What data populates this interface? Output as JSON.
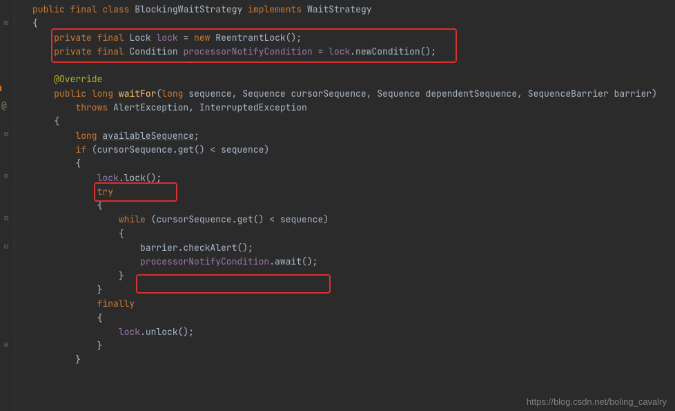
{
  "code": {
    "line0_public": "public",
    "line0_final": "final",
    "line0_class": "class",
    "line0_name": "BlockingWaitStrategy",
    "line0_implements": "implements",
    "line0_iface": "WaitStrategy",
    "brace_open": "{",
    "brace_close": "}",
    "field1_private": "private",
    "field1_final": "final",
    "field1_type": "Lock",
    "field1_name": "lock",
    "field1_eq": " = ",
    "field1_new": "new",
    "field1_ctor": "ReentrantLock()",
    "semi": ";",
    "field2_private": "private",
    "field2_final": "final",
    "field2_type": "Condition",
    "field2_name": "processorNotifyCondition",
    "field2_eq": " = ",
    "field2_rhs1": "lock",
    "field2_dot": ".",
    "field2_rhs2": "newCondition()",
    "ann_override": "@Override",
    "m_public": "public",
    "m_ret": "long",
    "m_name": "waitFor",
    "m_p1t": "long",
    "m_p1n": "sequence",
    "m_p2t": "Sequence",
    "m_p2n": "cursorSequence",
    "m_p3t": "Sequence",
    "m_p3n": "dependentSequence",
    "m_p4t": "SequenceBarrier",
    "m_p4n": "barrier",
    "throws": "throws",
    "ex1": "AlertException",
    "ex2": "InterruptedException",
    "body_longkw": "long",
    "body_avail": "availableSequence",
    "if_kw": "if",
    "if_cond": "(cursorSequence.get() < sequence)",
    "lock_call": "lock",
    "lock_dot": ".",
    "lock_method": "lock()",
    "try_kw": "try",
    "while_kw": "while",
    "while_cond": "(cursorSequence.get() < sequence)",
    "barrier_call": "barrier.checkAlert()",
    "pnc": "processorNotifyCondition",
    "pnc_dot": ".",
    "pnc_await": "await()",
    "finally_kw": "finally",
    "unlock_obj": "lock",
    "unlock_dot": ".",
    "unlock_m": "unlock()",
    "comma": ", "
  },
  "watermark": "https://blog.csdn.net/boling_cavalry",
  "gutter": {
    "at": "@"
  }
}
